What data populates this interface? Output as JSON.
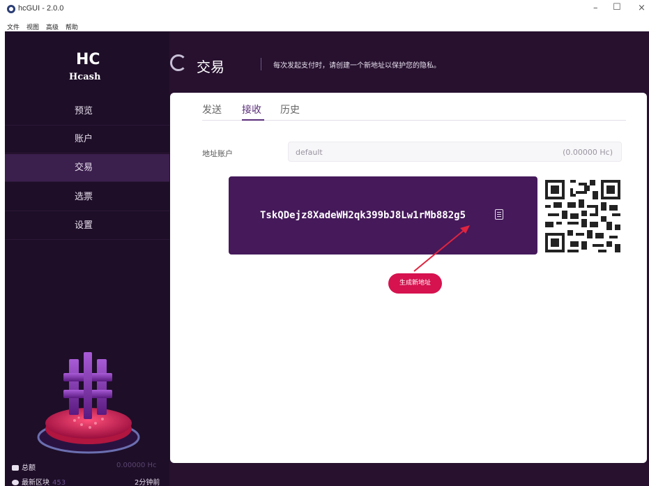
{
  "window": {
    "title": "hcGUI - 2.0.0",
    "min_glyph": "–",
    "max_glyph": "☐",
    "close_glyph": "×"
  },
  "menu": {
    "items": [
      "文件",
      "视图",
      "高级",
      "帮助"
    ]
  },
  "sidebar": {
    "logo_mark": "HC",
    "logo_text": "Hcash",
    "items": [
      {
        "label": "预览",
        "active": false
      },
      {
        "label": "账户",
        "active": false
      },
      {
        "label": "交易",
        "active": true
      },
      {
        "label": "选票",
        "active": false
      },
      {
        "label": "设置",
        "active": false
      }
    ],
    "footer": {
      "balance_label": "总额",
      "balance_value": "0.00000 Hc",
      "block_label": "最新区块",
      "block_number": "453",
      "block_time": "2分钟前"
    }
  },
  "header": {
    "title": "交易",
    "hint": "每次发起支付时，请创建一个新地址以保护您的隐私。"
  },
  "tabs": [
    {
      "label": "发送",
      "active": false
    },
    {
      "label": "接收",
      "active": true
    },
    {
      "label": "历史",
      "active": false
    }
  ],
  "receive": {
    "account_label": "地址账户",
    "account_value": "default",
    "account_balance": "(0.00000 Hc)",
    "address": "TskQDejz8XadeWH2qk399bJ8Lw1rMb882g5",
    "generate_label": "生成新地址"
  },
  "colors": {
    "sidebar_bg": "#1e0e28",
    "app_bg": "#27112f",
    "accent_purple": "#45195a",
    "button_red": "#d6124f"
  }
}
